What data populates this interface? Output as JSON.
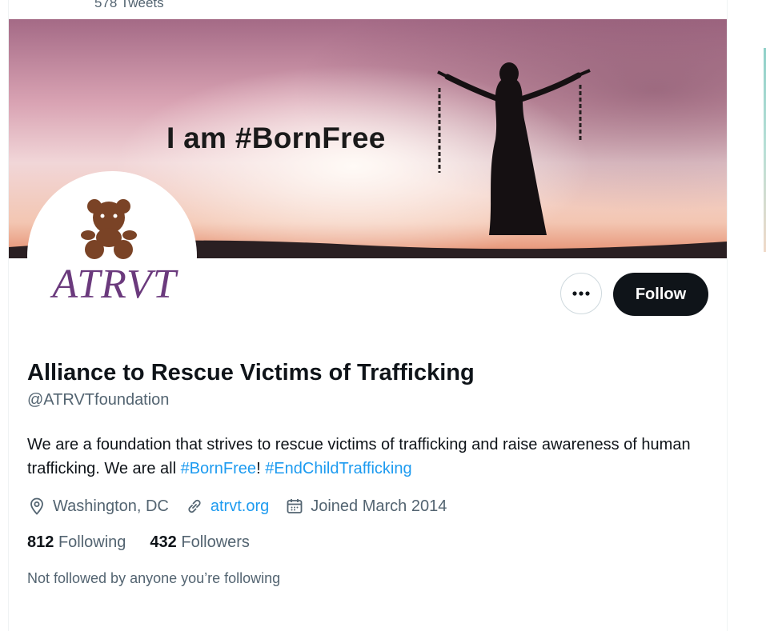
{
  "header": {
    "tweets_count": "578 Tweets"
  },
  "banner": {
    "text": "I am #BornFree"
  },
  "avatar": {
    "logo_text": "ATRVT"
  },
  "actions": {
    "follow_label": "Follow"
  },
  "profile": {
    "display_name": "Alliance to Rescue Victims of Trafficking",
    "handle": "@ATRVTfoundation",
    "bio_text_1": "We are a foundation that strives to rescue victims of trafficking and raise awareness of human trafficking. We are all ",
    "bio_hashtag_1": "#BornFree",
    "bio_text_2": "! ",
    "bio_hashtag_2": "#EndChildTrafficking",
    "location": "Washington, DC",
    "website": "atrvt.org",
    "joined": "Joined March 2014",
    "following_count": "812",
    "following_label": "Following",
    "followers_count": "432",
    "followers_label": "Followers",
    "not_followed_text": "Not followed by anyone you’re following"
  },
  "icons": [
    "more-icon",
    "location-icon",
    "link-icon",
    "calendar-icon"
  ],
  "colors": {
    "accent": "#1d9bf0",
    "button_bg": "#0f1419",
    "secondary_text": "#536471"
  }
}
